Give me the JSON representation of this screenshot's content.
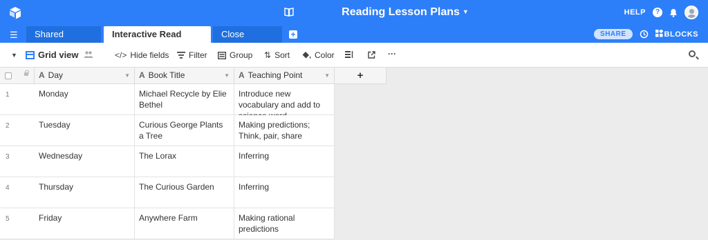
{
  "base": {
    "title": "Reading Lesson Plans"
  },
  "topbar": {
    "help_label": "HELP",
    "help_icon": "?"
  },
  "tabs": [
    {
      "label": "Shared Reading"
    },
    {
      "label": "Interactive Read Aloud"
    },
    {
      "label": "Close Reading"
    }
  ],
  "tabbar": {
    "share_label": "SHARE",
    "blocks_label": "BLOCKS"
  },
  "toolbar": {
    "view_label": "Grid view",
    "hide_fields": "Hide fields",
    "filter": "Filter",
    "group": "Group",
    "sort": "Sort",
    "color": "Color",
    "more": "···"
  },
  "columns": [
    {
      "label": "Day",
      "type_icon": "A"
    },
    {
      "label": "Book Title",
      "type_icon": "A"
    },
    {
      "label": "Teaching Point",
      "type_icon": "A"
    }
  ],
  "add_column": "+",
  "rows": [
    {
      "num": "1",
      "day": "Monday",
      "book": "Michael Recycle by Elie Bethel",
      "teaching_point": "Introduce new vocabulary and add to science word …"
    },
    {
      "num": "2",
      "day": "Tuesday",
      "book": "Curious George Plants a Tree",
      "teaching_point": "Making predictions; Think, pair, share"
    },
    {
      "num": "3",
      "day": "Wednesday",
      "book": "The Lorax",
      "teaching_point": "Inferring"
    },
    {
      "num": "4",
      "day": "Thursday",
      "book": "The Curious Garden",
      "teaching_point": "Inferring"
    },
    {
      "num": "5",
      "day": "Friday",
      "book": "Anywhere Farm",
      "teaching_point": "Making rational predictions"
    }
  ],
  "colors": {
    "brand_blue": "#2d7ff9",
    "inactive_tab": "#1f6fe0"
  }
}
